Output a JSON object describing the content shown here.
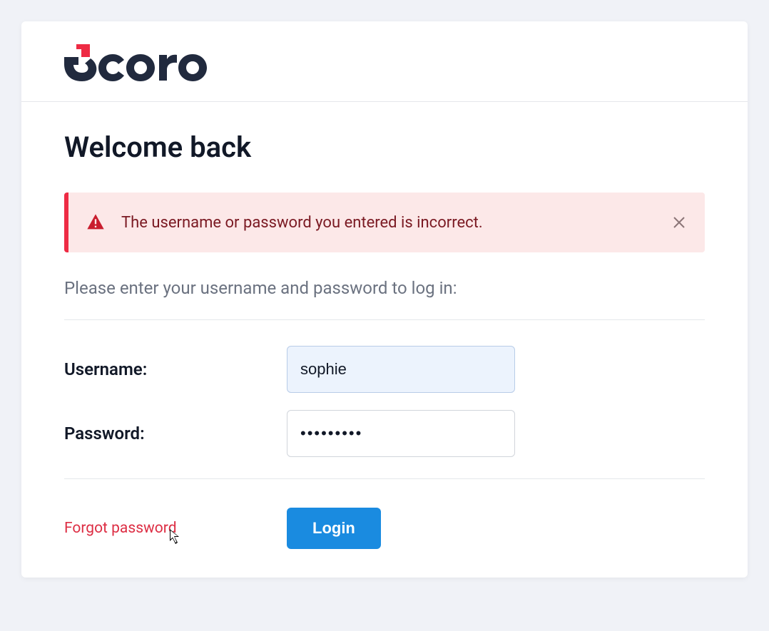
{
  "brand": {
    "name": "Scoro",
    "accentColor": "#ee2b44",
    "textColor": "#212a3e"
  },
  "page": {
    "title": "Welcome back",
    "instructions": "Please enter your username and password to log in:"
  },
  "alert": {
    "message": "The username or password you entered is incorrect."
  },
  "form": {
    "usernameLabel": "Username:",
    "usernameValue": "sophie",
    "passwordLabel": "Password:",
    "passwordValue": "•••••••••"
  },
  "footer": {
    "forgotLink": "Forgot password",
    "loginButton": "Login"
  }
}
